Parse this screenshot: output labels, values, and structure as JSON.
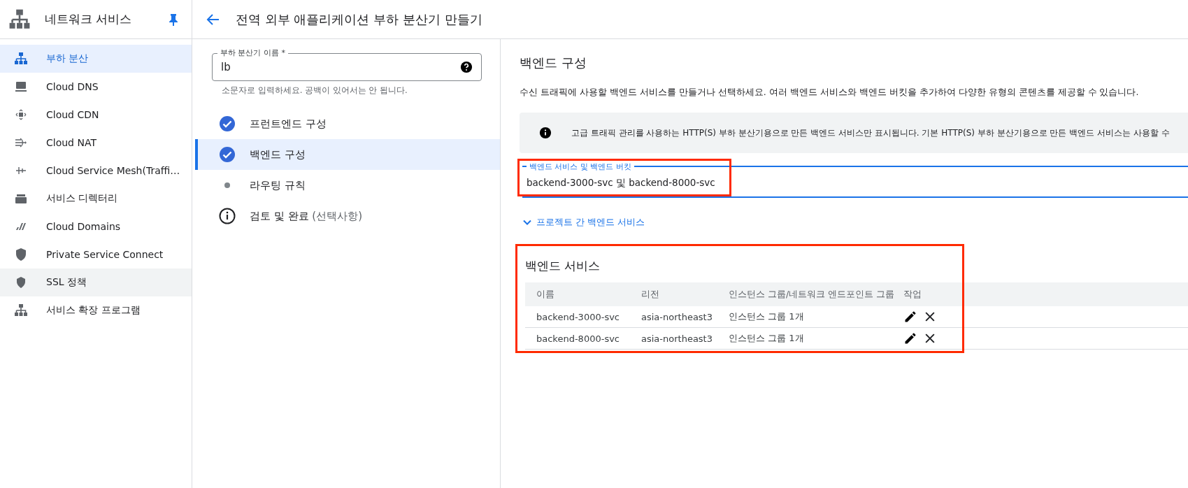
{
  "sidebar": {
    "title": "네트워크 서비스",
    "pinned": true,
    "items": [
      {
        "label": "부하 분산",
        "selected": true,
        "hovered": false
      },
      {
        "label": "Cloud DNS",
        "selected": false,
        "hovered": false
      },
      {
        "label": "Cloud CDN",
        "selected": false,
        "hovered": false
      },
      {
        "label": "Cloud NAT",
        "selected": false,
        "hovered": false
      },
      {
        "label": "Cloud Service Mesh(Traffi…",
        "selected": false,
        "hovered": false
      },
      {
        "label": "서비스 디렉터리",
        "selected": false,
        "hovered": false
      },
      {
        "label": "Cloud Domains",
        "selected": false,
        "hovered": false
      },
      {
        "label": "Private Service Connect",
        "selected": false,
        "hovered": false
      },
      {
        "label": "SSL 정책",
        "selected": false,
        "hovered": true
      },
      {
        "label": "서비스 확장 프로그램",
        "selected": false,
        "hovered": false
      }
    ]
  },
  "page_title": "전역 외부 애플리케이션 부하 분산기 만들기",
  "name_field": {
    "label": "부하 분산기 이름 *",
    "value": "lb",
    "hint": "소문자로 입력하세요. 공백이 있어서는 안 됩니다."
  },
  "steps": [
    {
      "label": "프런트엔드 구성",
      "kind": "done",
      "selected": false
    },
    {
      "label": "백엔드 구성",
      "kind": "done",
      "selected": true
    },
    {
      "label": "라우팅 규칙",
      "kind": "pending",
      "selected": false
    },
    {
      "label": "검토 및 완료",
      "note": "(선택사항)",
      "kind": "optional",
      "selected": false
    }
  ],
  "backend": {
    "title": "백엔드 구성",
    "description": "수신 트래픽에 사용할 백엔드 서비스를 만들거나 선택하세요. 여러 백엔드 서비스와 백엔드 버킷을 추가하여 다양한 유형의 콘텐츠를 제공할 수 있습니다.",
    "info": "고급 트래픽 관리를 사용하는 HTTP(S) 부하 분산기용으로 만든 백엔드 서비스만 표시됩니다. 기본 HTTP(S) 부하 분산기용으로 만든 백엔드 서비스는 사용할 수",
    "select": {
      "label": "백엔드 서비스 및 백엔드 버킷",
      "value": "backend-3000-svc 및 backend-8000-svc"
    },
    "cross_project_link": "프로젝트 간 백엔드 서비스",
    "services_title": "백엔드 서비스",
    "table": {
      "columns": [
        "이름",
        "리전",
        "인스턴스 그룹/네트워크 엔드포인트 그룹",
        "작업"
      ],
      "rows": [
        [
          "backend-3000-svc",
          "asia-northeast3",
          "인스턴스 그룹 1개"
        ],
        [
          "backend-8000-svc",
          "asia-northeast3",
          "인스턴스 그룹 1개"
        ]
      ]
    }
  }
}
